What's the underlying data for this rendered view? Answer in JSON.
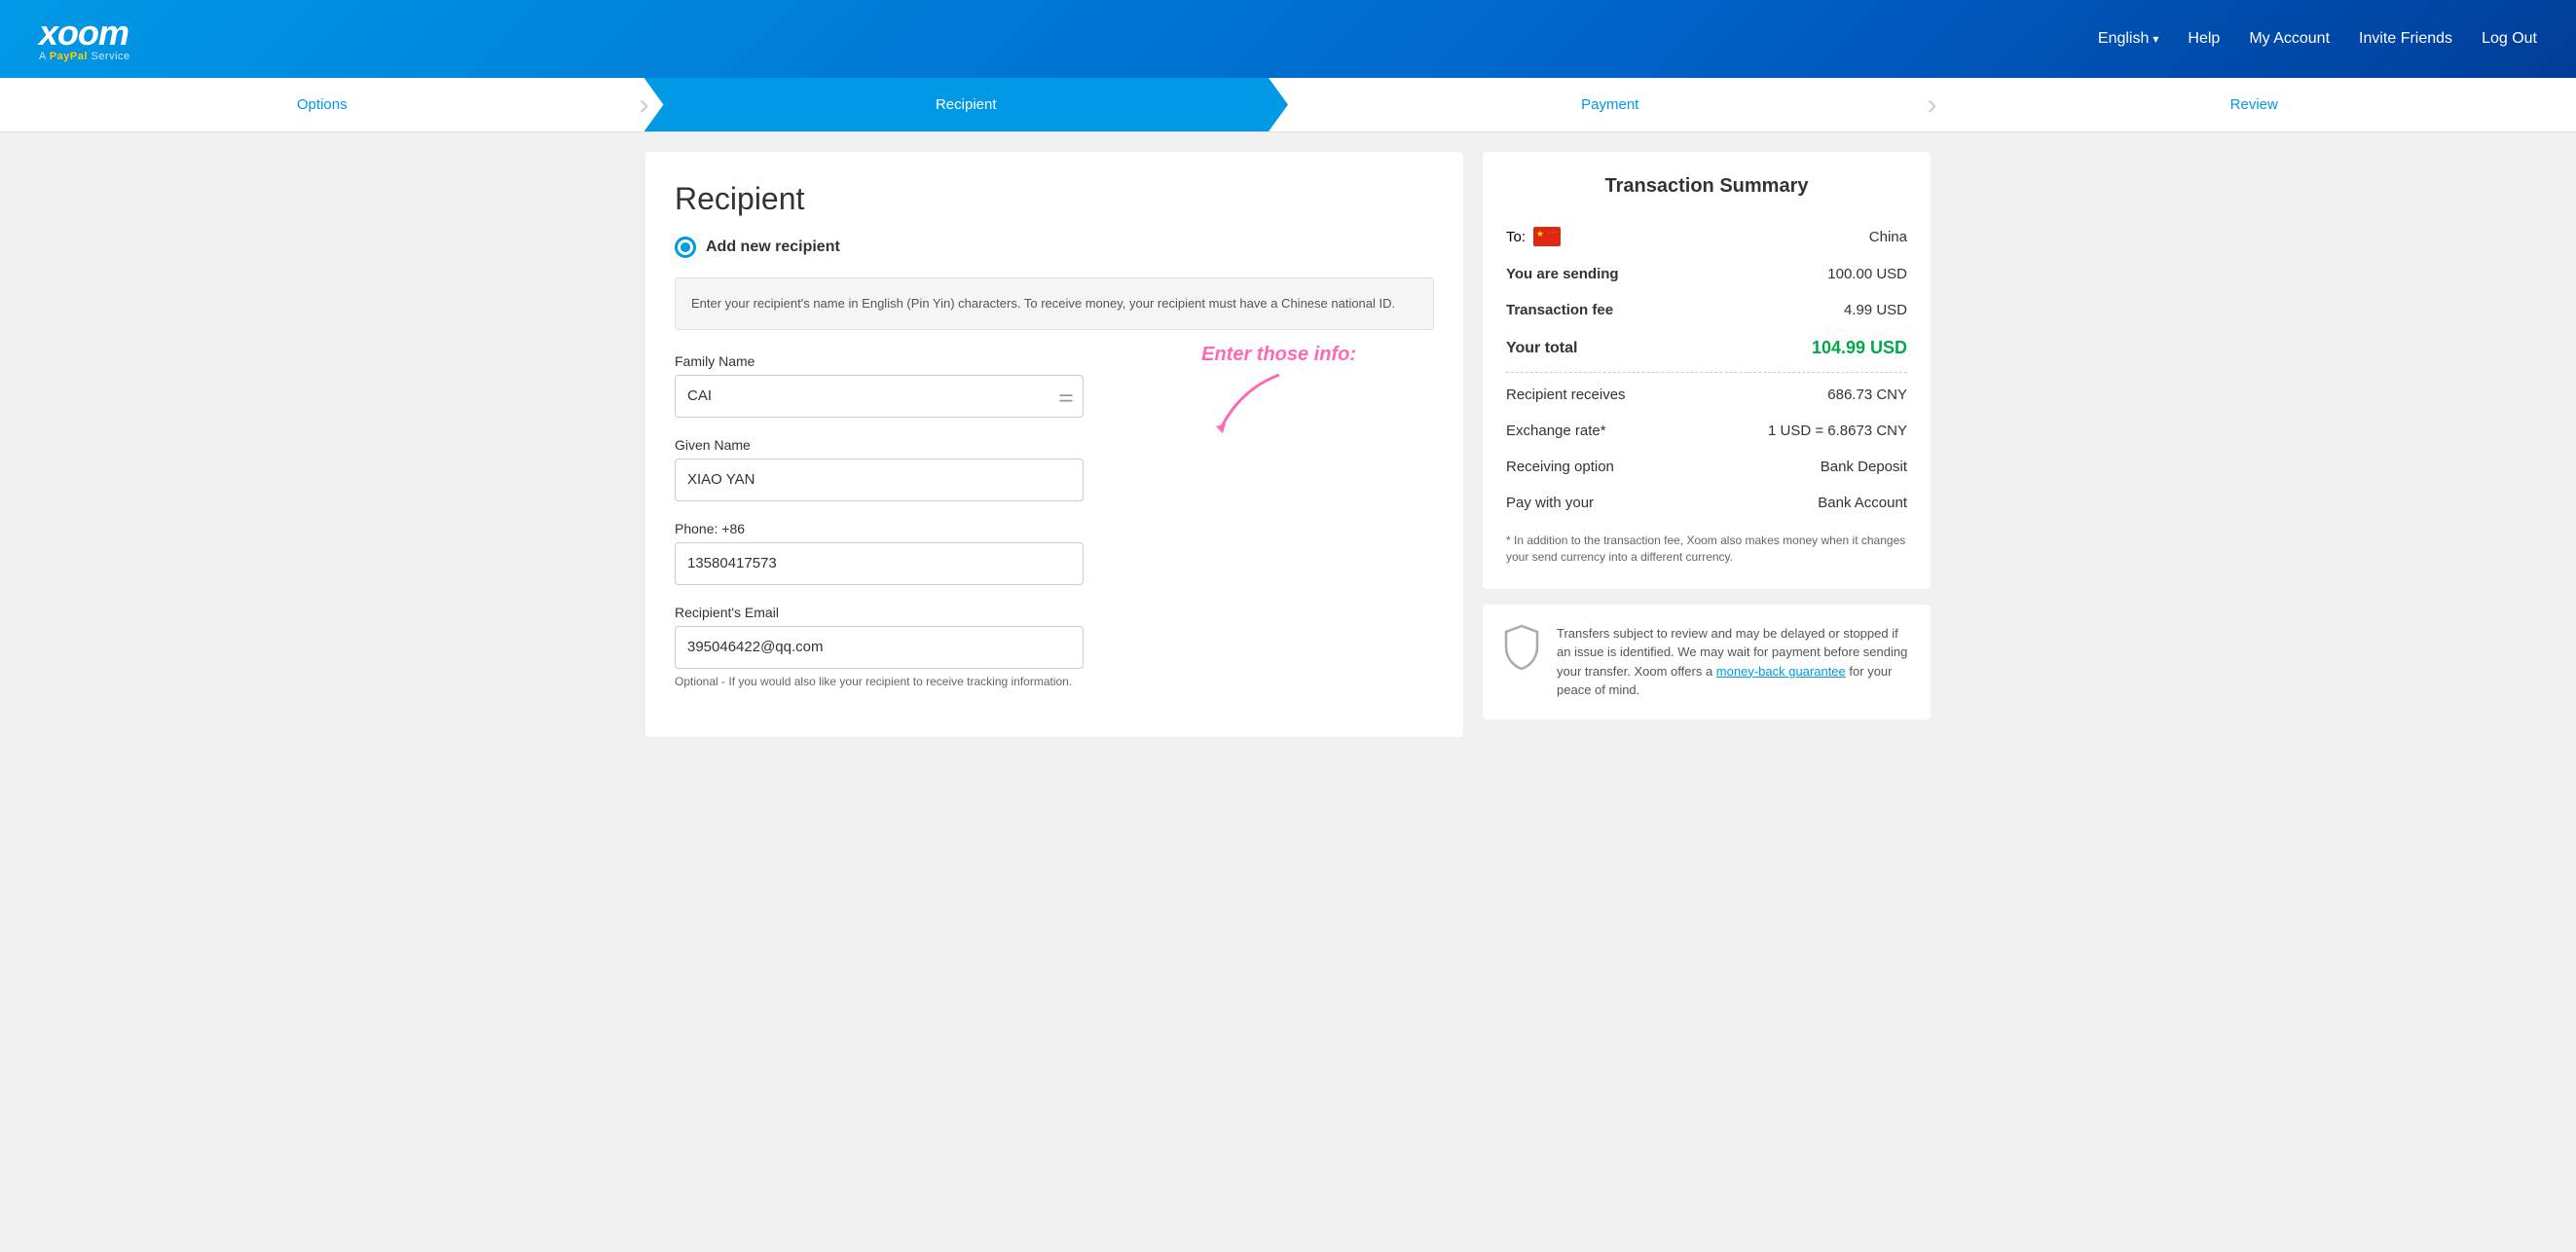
{
  "header": {
    "logo_main": "xoom",
    "logo_sub": "A PayPal Service",
    "nav": {
      "english_label": "English",
      "help_label": "Help",
      "my_account_label": "My Account",
      "invite_friends_label": "Invite Friends",
      "log_out_label": "Log Out"
    }
  },
  "progress": {
    "steps": [
      {
        "label": "Options",
        "state": "inactive"
      },
      {
        "label": "Recipient",
        "state": "active"
      },
      {
        "label": "Payment",
        "state": "inactive"
      },
      {
        "label": "Review",
        "state": "inactive"
      }
    ]
  },
  "recipient_form": {
    "title": "Recipient",
    "add_new_label": "Add new recipient",
    "info_text": "Enter your recipient's name in English (Pin Yin) characters. To receive money, your recipient must have a Chinese national ID.",
    "annotation_text": "Enter those info:",
    "family_name_label": "Family Name",
    "family_name_value": "CAI",
    "given_name_label": "Given Name",
    "given_name_value": "XIAO YAN",
    "phone_label": "Phone: +86",
    "phone_value": "13580417573",
    "email_label": "Recipient's Email",
    "email_value": "395046422@qq.com",
    "email_optional_text": "Optional - If you would also like your recipient to receive tracking information."
  },
  "transaction_summary": {
    "title": "Transaction Summary",
    "to_label": "To:",
    "to_country": "China",
    "you_are_sending_label": "You are sending",
    "you_are_sending_value": "100.00  USD",
    "transaction_fee_label": "Transaction fee",
    "transaction_fee_value": "4.99  USD",
    "your_total_label": "Your total",
    "your_total_value": "104.99  USD",
    "recipient_receives_label": "Recipient receives",
    "recipient_receives_value": "686.73  CNY",
    "exchange_rate_label": "Exchange rate*",
    "exchange_rate_value": "1 USD = 6.8673 CNY",
    "receiving_option_label": "Receiving option",
    "receiving_option_value": "Bank Deposit",
    "pay_with_label": "Pay with your",
    "pay_with_value": "Bank Account",
    "footnote": "* In addition to the transaction fee, Xoom also makes money when it changes your send currency into a different currency.",
    "security_text_1": "Transfers subject to review and may be delayed or stopped if an issue is identified. We may wait for payment before sending your transfer. Xoom offers a ",
    "security_link": "money-back guarantee",
    "security_text_2": " for your peace of mind."
  }
}
